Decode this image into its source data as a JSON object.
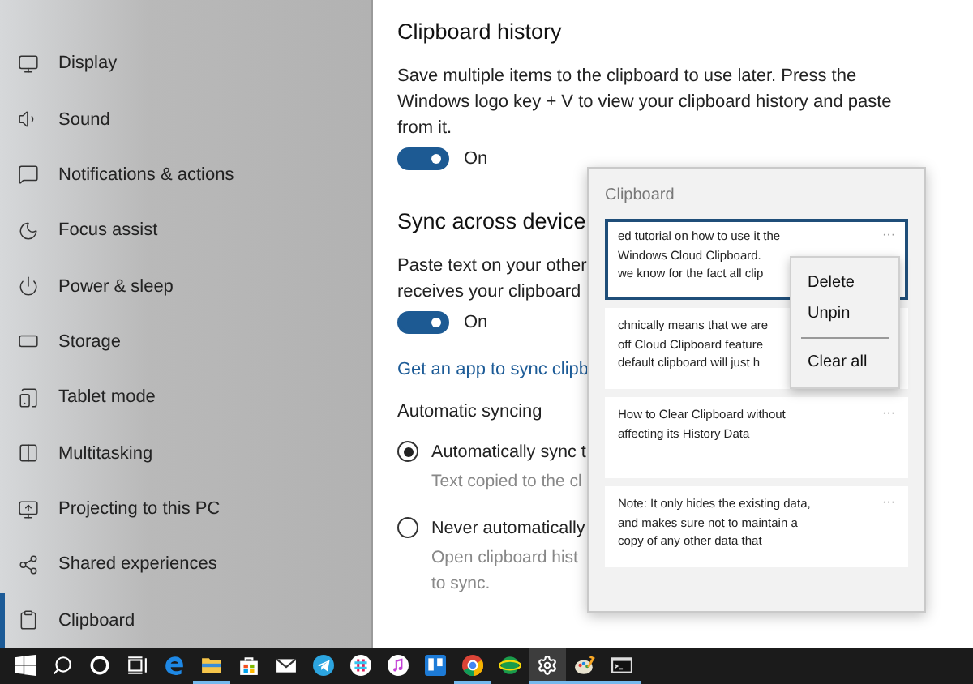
{
  "sidebar": {
    "items": [
      {
        "label": "Display",
        "selected": false
      },
      {
        "label": "Sound",
        "selected": false
      },
      {
        "label": "Notifications & actions",
        "selected": false
      },
      {
        "label": "Focus assist",
        "selected": false
      },
      {
        "label": "Power & sleep",
        "selected": false
      },
      {
        "label": "Storage",
        "selected": false
      },
      {
        "label": "Tablet mode",
        "selected": false
      },
      {
        "label": "Multitasking",
        "selected": false
      },
      {
        "label": "Projecting to this PC",
        "selected": false
      },
      {
        "label": "Shared experiences",
        "selected": false
      },
      {
        "label": "Clipboard",
        "selected": true
      }
    ]
  },
  "clipboard_history": {
    "heading": "Clipboard history",
    "description": "Save multiple items to the clipboard to use later. Press the Windows logo key + V to view your clipboard history and paste from it.",
    "toggle": {
      "on": true,
      "label": "On"
    }
  },
  "sync": {
    "heading": "Sync across device",
    "description_lines": [
      "Paste text on your other",
      "receives your clipboard"
    ],
    "toggle": {
      "on": true,
      "label": "On"
    },
    "link": "Get an app to sync clipb",
    "subheading": "Automatic syncing",
    "options": [
      {
        "label": "Automatically sync t",
        "hint_lines": [
          "Text copied to the cl"
        ],
        "selected": true
      },
      {
        "label": "Never automatically",
        "hint_lines": [
          "Open clipboard hist",
          "to sync."
        ],
        "selected": false
      }
    ]
  },
  "clipboard_panel": {
    "title": "Clipboard",
    "items": [
      {
        "text": "ed tutorial on how to use it the\nWindows Cloud Clipboard.\nwe know for the fact all clip",
        "selected": true,
        "more": "···"
      },
      {
        "text": "chnically means that we are\noff Cloud Clipboard feature\ndefault clipboard will just h",
        "selected": false
      },
      {
        "text": "How to Clear Clipboard without\naffecting its History Data",
        "selected": false,
        "more": "···"
      },
      {
        "text": "Note: It only hides the existing data,\nand makes sure not to maintain a\ncopy of any other data that",
        "selected": false,
        "more": "···"
      }
    ],
    "context_menu": [
      {
        "label": "Delete",
        "kind": "item"
      },
      {
        "label": "Unpin",
        "kind": "item"
      },
      {
        "kind": "divider"
      },
      {
        "label": "Clear all",
        "kind": "item"
      }
    ]
  },
  "taskbar": {
    "apps": [
      {
        "kind": "start",
        "running": false,
        "selected": false
      },
      {
        "kind": "search",
        "running": false,
        "selected": false
      },
      {
        "kind": "cortana",
        "running": false,
        "selected": false
      },
      {
        "kind": "taskview",
        "running": false,
        "selected": false
      },
      {
        "kind": "edge",
        "running": false,
        "selected": false
      },
      {
        "kind": "folder",
        "running": true,
        "selected": false
      },
      {
        "kind": "store",
        "running": false,
        "selected": false
      },
      {
        "kind": "mail",
        "running": false,
        "selected": false
      },
      {
        "kind": "telegram",
        "running": false,
        "selected": false
      },
      {
        "kind": "slack",
        "running": false,
        "selected": false
      },
      {
        "kind": "music",
        "running": false,
        "selected": false
      },
      {
        "kind": "trello",
        "running": false,
        "selected": false
      },
      {
        "kind": "chrome",
        "running": true,
        "selected": false
      },
      {
        "kind": "app",
        "running": false,
        "selected": false
      },
      {
        "kind": "settings",
        "running": true,
        "selected": true
      },
      {
        "kind": "paint",
        "running": true,
        "selected": false
      },
      {
        "kind": "terminal",
        "running": true,
        "selected": false
      }
    ]
  }
}
